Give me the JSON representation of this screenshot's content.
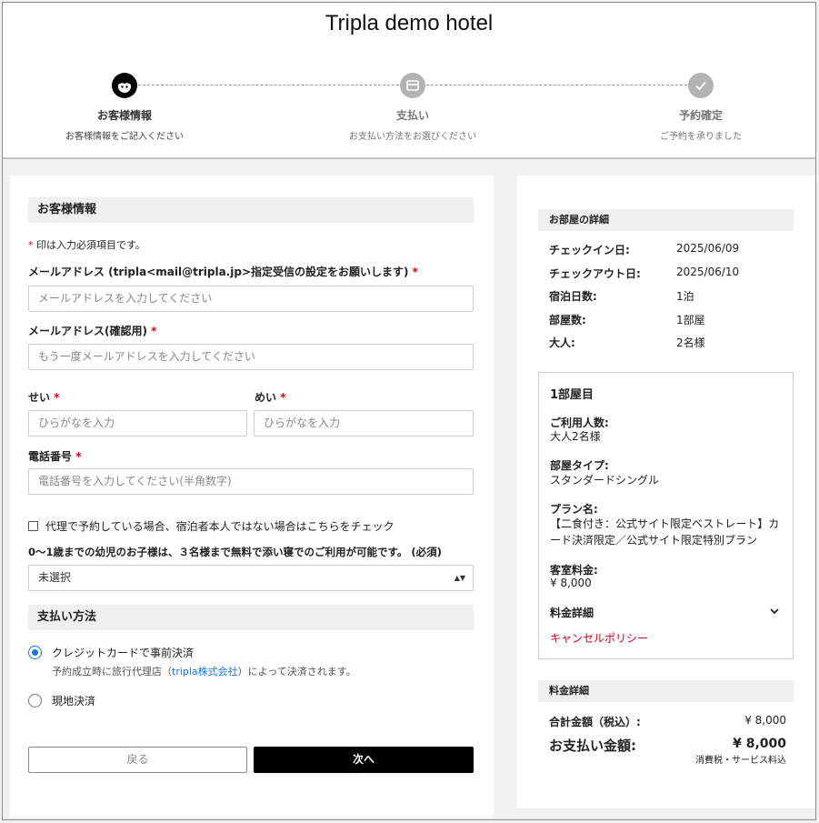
{
  "header": {
    "hotel_name": "Tripla demo hotel",
    "steps": [
      {
        "title": "お客様情報",
        "subtitle": "お客様情報をご記入ください",
        "icon": "face-icon",
        "state": "active"
      },
      {
        "title": "支払い",
        "subtitle": "お支払い方法をお選びください",
        "icon": "card-icon",
        "state": "inactive"
      },
      {
        "title": "予約確定",
        "subtitle": "ご予約を承りました",
        "icon": "check-icon",
        "state": "inactive"
      }
    ]
  },
  "form": {
    "section_title": "お客様情報",
    "required_note": "印は入力必須項目です。",
    "required_mark": "*",
    "email_label": "メールアドレス (tripla<mail@tripla.jp>指定受信の設定をお願いします)",
    "email_placeholder": "メールアドレスを入力してください",
    "email_confirm_label": "メールアドレス(確認用)",
    "email_confirm_placeholder": "もう一度メールアドレスを入力してください",
    "last_name_label": "せい",
    "last_name_placeholder": "ひらがなを入力",
    "first_name_label": "めい",
    "first_name_placeholder": "ひらがなを入力",
    "phone_label": "電話番号",
    "phone_placeholder": "電話番号を入力してください(半角数字)",
    "proxy_checkbox_label": "代理で予約している場合、宿泊者本人ではない場合はこちらをチェック",
    "infant_label": "0〜1歳までの幼児のお子様は、３名様まで無料で添い寝でのご利用が可能です。 (必須)",
    "infant_select_value": "未選択"
  },
  "payment": {
    "section_title": "支払い方法",
    "option_card": "クレジットカードで事前決済",
    "card_note_prefix": "予約成立時に旅行代理店（",
    "card_note_link": "tripla株式会社",
    "card_note_suffix": "）によって決済されます。",
    "option_onsite": "現地決済",
    "selected": "card"
  },
  "buttons": {
    "back": "戻る",
    "next": "次へ"
  },
  "room_summary": {
    "title": "お部屋の詳細",
    "rows": [
      {
        "key": "チェックイン日:",
        "value": "2025/06/09"
      },
      {
        "key": "チェックアウト日:",
        "value": "2025/06/10"
      },
      {
        "key": "宿泊日数:",
        "value": "1泊"
      },
      {
        "key": "部屋数:",
        "value": "1部屋"
      },
      {
        "key": "大人:",
        "value": "2名様"
      }
    ]
  },
  "room1": {
    "title": "1部屋目",
    "guests_label": "ご利用人数:",
    "guests_value": "大人2名様",
    "type_label": "部屋タイプ:",
    "type_value": "スタンダードシングル",
    "plan_label": "プラン名:",
    "plan_value": "【二食付き：公式サイト限定ベストレート】カード決済限定／公式サイト限定特別プラン",
    "fee_label": "客室料金:",
    "fee_value": "¥ 8,000",
    "fee_detail_label": "料金詳細",
    "cancel_policy": "キャンセルポリシー"
  },
  "price_summary": {
    "title": "料金詳細",
    "total_label": "合計金額（税込）:",
    "total_value": "¥ 8,000",
    "pay_label": "お支払い金額:",
    "pay_value": "¥ 8,000",
    "tax_note": "消費税・サービス料込"
  },
  "colors": {
    "required": "#d0021b",
    "link": "#1a73e8",
    "primary_button": "#000000"
  }
}
